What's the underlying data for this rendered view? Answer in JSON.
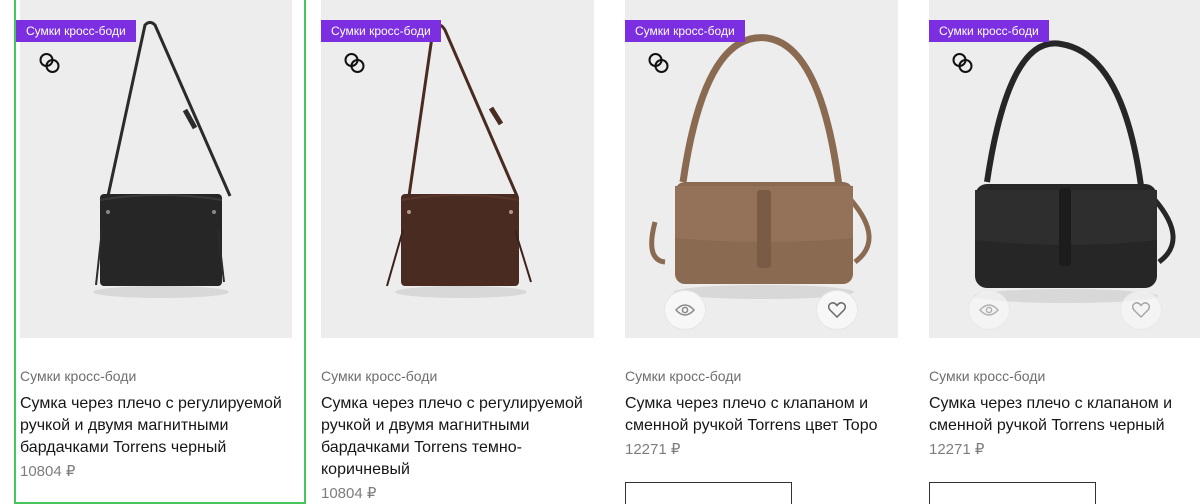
{
  "products": [
    {
      "badge": "Сумки кросс-боди",
      "category": "Сумки кросс-боди",
      "title": "Сумка через плечо с регулируемой ручкой и двумя магнитными бардачками Torrens черный",
      "price": "10804 ₽",
      "bag_color": "#262626",
      "selected": true
    },
    {
      "badge": "Сумки кросс-боди",
      "category": "Сумки кросс-боди",
      "title": "Сумка через плечо с регулируемой ручкой и двумя магнитными бардачками Torrens темно-коричневый",
      "price": "10804 ₽",
      "bag_color": "#4a2b22",
      "selected": false
    },
    {
      "badge": "Сумки кросс-боди",
      "category": "Сумки кросс-боди",
      "title": "Сумка через плечо с клапаном и сменной ручкой Torrens цвет Topo",
      "price": "12271 ₽",
      "bag_color": "#8b6a52",
      "selected": false
    },
    {
      "badge": "Сумки кросс-боди",
      "category": "Сумки кросс-боди",
      "title": "Сумка через плечо с клапаном и сменной ручкой Torrens черный",
      "price": "12271 ₽",
      "bag_color": "#262626",
      "selected": false
    }
  ],
  "colors": {
    "badge_bg": "#7b2fe0",
    "selected_border": "#47c45a",
    "photo_bg": "#ededed"
  },
  "icons": {
    "compare": "compare-icon",
    "quick_view": "eye-icon",
    "favorite": "heart-icon"
  }
}
